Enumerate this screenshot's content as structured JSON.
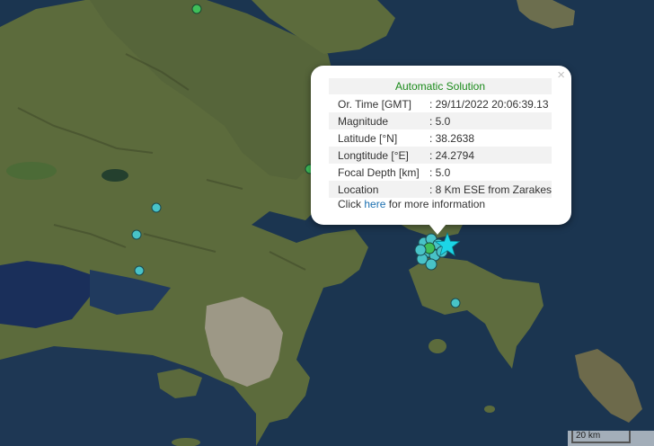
{
  "map": {
    "land_color": "#5c6b3c",
    "water_color": "#1b3550",
    "urban_color": "#a8a093",
    "event_marker_color": "#1cd6e6",
    "event_marker_shape": "star-icon",
    "marker_color": "#48c3c8",
    "marker_shape": "circle"
  },
  "popup": {
    "close_glyph": "×",
    "title": "Automatic Solution",
    "rows": [
      {
        "label": "Or. Time [GMT]",
        "value": ": 29/11/2022 20:06:39.13"
      },
      {
        "label": "Magnitude",
        "value": ": 5.0"
      },
      {
        "label": "Latitude [°N]",
        "value": ": 38.2638"
      },
      {
        "label": "Longtitude [°E]",
        "value": ": 24.2794"
      },
      {
        "label": "Focal Depth [km]",
        "value": ": 5.0"
      },
      {
        "label": "Location",
        "value": ": 8 Km ESE from Zarakes"
      }
    ],
    "more_info_prefix": "Click ",
    "more_info_link": "here",
    "more_info_suffix": " for more information"
  },
  "scale": {
    "label": "20 km"
  }
}
